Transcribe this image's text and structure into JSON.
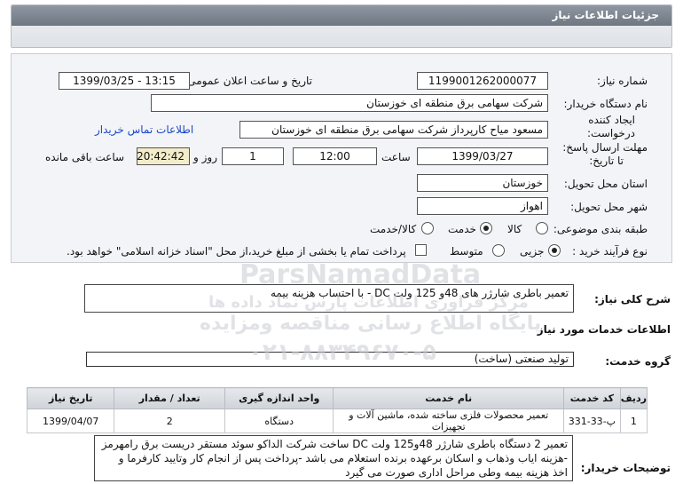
{
  "header": {
    "title": "جزئیات اطلاعات نیاز"
  },
  "form": {
    "need_number_label": "شماره نیاز:",
    "need_number": "1199001262000077",
    "announce_label": "تاریخ و ساعت اعلان عمومی:",
    "announce_value": "1399/03/25 - 13:15",
    "buyer_label": "نام دستگاه خریدار:",
    "buyer_value": "شرکت سهامی برق منطقه ای خوزستان",
    "creator_label_1": "ایجاد کننده",
    "creator_label_2": "درخواست:",
    "creator_value": "مسعود میاح کارپرداز شرکت سهامی برق منطقه ای خوزستان",
    "contact_link": "اطلاعات تماس خریدار",
    "deadline_label_1": "مهلت ارسال پاسخ:",
    "deadline_label_2": "تا تاریخ:",
    "deadline_date": "1399/03/27",
    "time_label": "ساعت",
    "deadline_time": "12:00",
    "days_value": "1",
    "days_label": "روز و",
    "remaining_time": "20:42:42",
    "remaining_label": "ساعت باقی مانده",
    "province_label": "استان محل تحویل:",
    "province_value": "خوزستان",
    "city_label": "شهر محل تحویل:",
    "city_value": "اهواز",
    "category_label": "طبقه بندی موضوعی:",
    "category_options": [
      "کالا",
      "خدمت",
      "کالا/خدمت"
    ],
    "category_selected": 1,
    "process_label": "نوع فرآیند خرید :",
    "process_options": [
      "جزیی",
      "متوسط"
    ],
    "process_selected": 0,
    "payment_note": "پرداخت تمام یا بخشی از مبلغ خرید،از محل \"اسناد خزانه اسلامی\" خواهد بود."
  },
  "summary": {
    "label": "شرح کلی نیاز:",
    "value": "تعمیر باطری شارژر های 48و 125 ولت DC - با احتساب هزینه بیمه"
  },
  "services": {
    "section_title": "اطلاعات خدمات مورد نیاز",
    "group_label": "گروه خدمت:",
    "group_value": "تولید صنعتی (ساخت)",
    "columns": [
      "ردیف",
      "کد خدمت",
      "نام خدمت",
      "واحد اندازه گیری",
      "تعداد / مقدار",
      "تاریخ نیاز"
    ],
    "rows": [
      [
        "1",
        "پ-33-331",
        "تعمیر محصولات فلزی ساخته شده، ماشین آلات و تجهیزات",
        "دستگاه",
        "2",
        "1399/04/07"
      ]
    ]
  },
  "buyer_notes": {
    "label": "توضیحات خریدار:",
    "lines": [
      "تعمیر 2 دستگاه باطری شارژر 48و125 ولت DC ساخت شرکت الداکو سوئد مستقر دریست برق رامهرمز",
      "-هزینه ایاب وذهاب و اسکان برعهده برنده استعلام می باشد -پرداخت پس از انجام کار وتایید کارفرما و",
      "اخذ هزینه بیمه وطی مراحل اداری صورت می گیرد"
    ]
  },
  "watermark": {
    "line1": "ParsNamadData",
    "line2": "مرکز فراوری اطلاعات پارس نماد داده ها",
    "line3": "پایگاه اطلاع رسانی مناقصه ومزایده",
    "line4": "۰۲۱-۸۸۳۴۹۶۷۰-۵"
  },
  "colors": {
    "header": "#7a828d",
    "link": "#1a47c7",
    "timer_bg": "#f2ecc9"
  }
}
